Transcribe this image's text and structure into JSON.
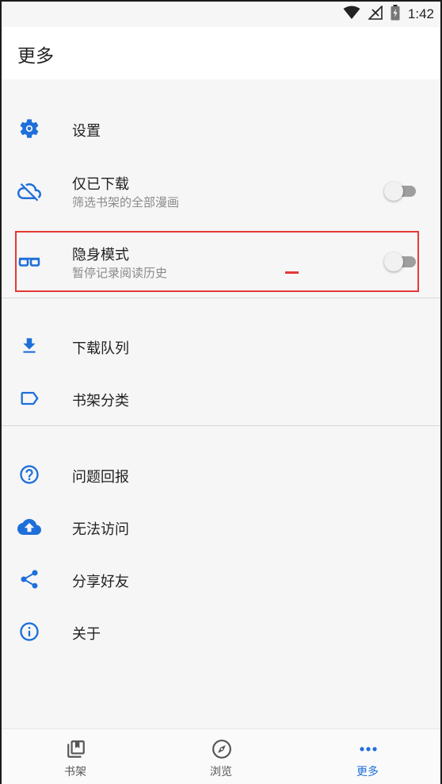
{
  "status_bar": {
    "time": "1:42",
    "icons": [
      "wifi-icon",
      "signal-icon",
      "battery-icon"
    ]
  },
  "header": {
    "title": "更多"
  },
  "menu": {
    "settings": {
      "label": "设置",
      "icon": "gear-icon"
    },
    "downloaded_only": {
      "label": "仅已下载",
      "subtitle": "筛选书架的全部漫画",
      "icon": "cloud-off-icon",
      "enabled": false
    },
    "incognito": {
      "label": "隐身模式",
      "subtitle": "暂停记录阅读历史",
      "icon": "glasses-icon",
      "enabled": false
    },
    "download_queue": {
      "label": "下载队列",
      "icon": "download-icon"
    },
    "categories": {
      "label": "书架分类",
      "icon": "label-icon"
    },
    "report": {
      "label": "问题回报",
      "icon": "help-icon"
    },
    "cannot_access": {
      "label": "无法访问",
      "icon": "cloud-upload-icon"
    },
    "share": {
      "label": "分享好友",
      "icon": "share-icon"
    },
    "about": {
      "label": "关于",
      "icon": "info-icon"
    }
  },
  "bottom_nav": {
    "items": [
      {
        "label": "书架",
        "icon": "library-icon",
        "active": false
      },
      {
        "label": "浏览",
        "icon": "compass-icon",
        "active": false
      },
      {
        "label": "更多",
        "icon": "more-icon",
        "active": true
      }
    ]
  },
  "colors": {
    "accent": "#1e6fd9",
    "highlight": "#e53935",
    "background": "#f6f6f6"
  }
}
